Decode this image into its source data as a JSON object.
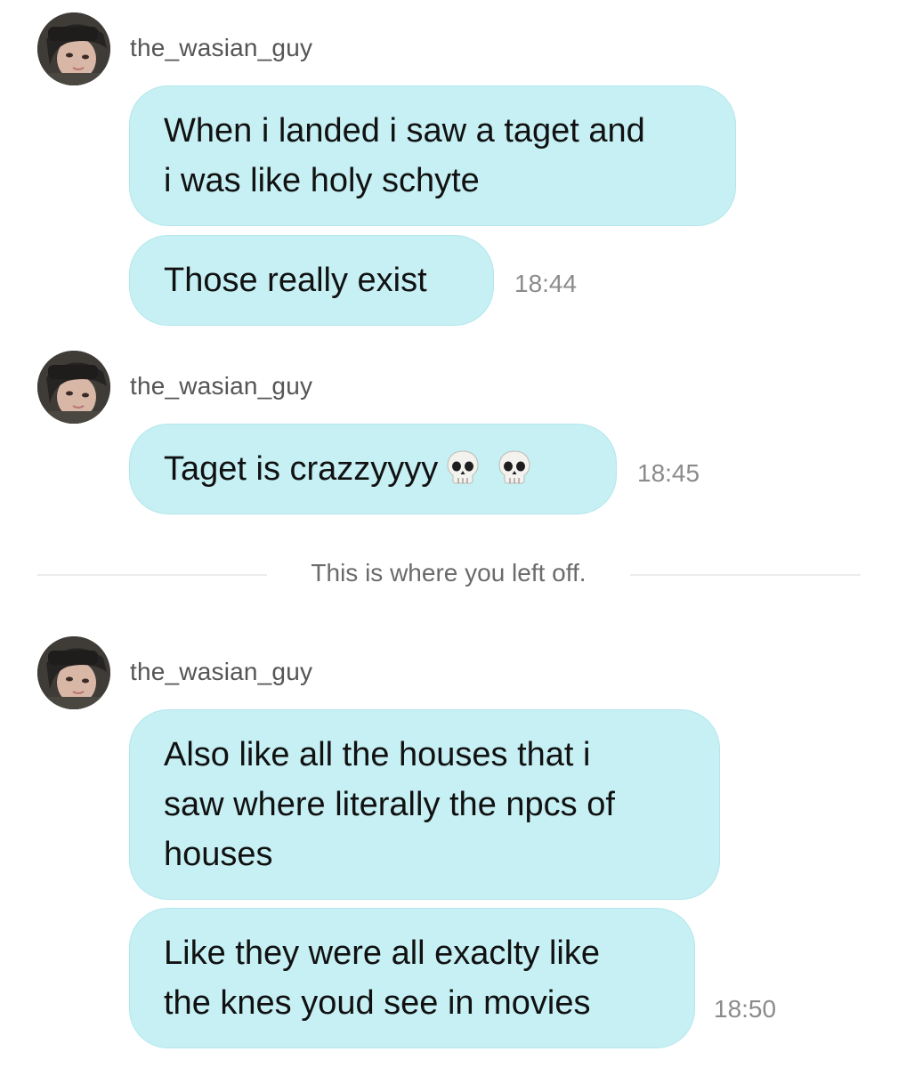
{
  "messages": [
    {
      "username": "the_wasian_guy",
      "bubbles": [
        "When i landed i saw a taget and\ni was like holy schyte",
        "Those really exist"
      ],
      "time": "18:44"
    },
    {
      "username": "the_wasian_guy",
      "bubbles": [
        "Taget is crazzyyyy"
      ],
      "emoji": [
        "skull-emoji",
        "skull-emoji"
      ],
      "time": "18:45"
    },
    {
      "username": "the_wasian_guy",
      "bubbles": [
        "Also like all the houses that i\nsaw where literally the npcs of\nhouses",
        "Like they were all exaclty like\nthe knes youd see in movies"
      ],
      "time": "18:50"
    }
  ],
  "divider": {
    "text": "This is where you left off."
  },
  "colors": {
    "bubble": "#c6f0f4",
    "username": "#555555",
    "timestamp": "#8b8b8b"
  },
  "icons": {
    "avatar": "user-avatar",
    "emoji": "skull-emoji"
  }
}
